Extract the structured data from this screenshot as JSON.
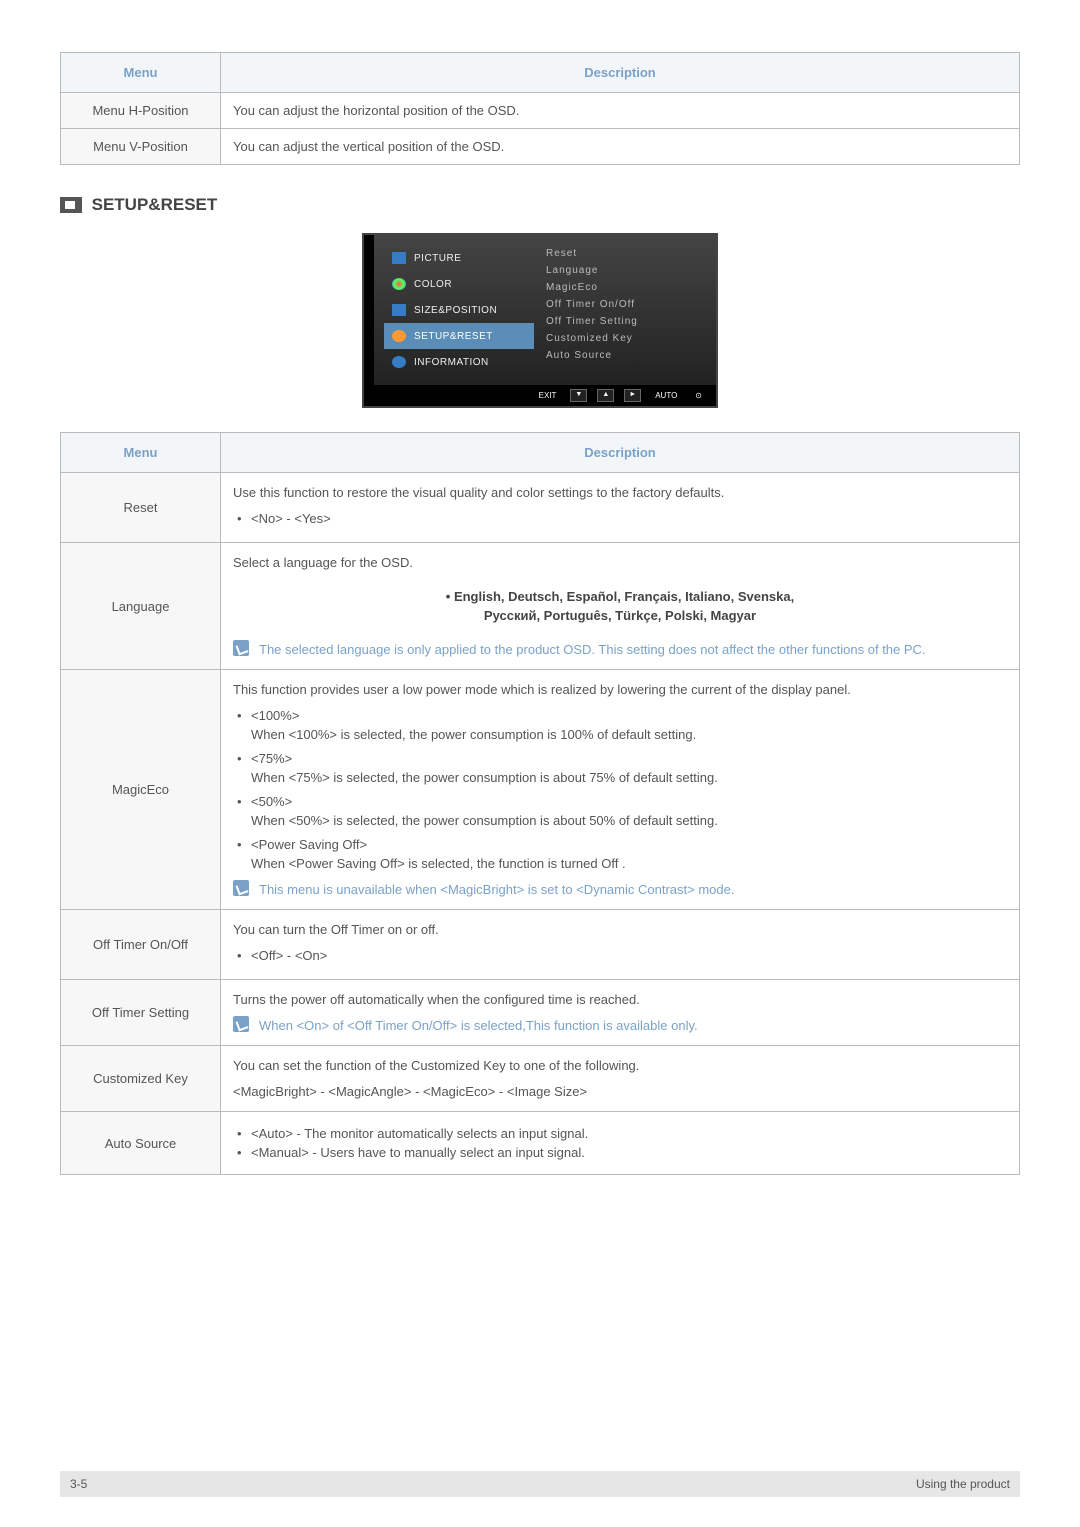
{
  "table1": {
    "headers": {
      "menu": "Menu",
      "description": "Description"
    },
    "rows": [
      {
        "menu": "Menu H-Position",
        "desc": "You can adjust the horizontal position of the OSD."
      },
      {
        "menu": "Menu V-Position",
        "desc": "You can adjust the vertical position of the OSD."
      }
    ]
  },
  "section_header": "SETUP&RESET",
  "osd": {
    "left": [
      {
        "label": "PICTURE",
        "icon": "mi-picture"
      },
      {
        "label": "COLOR",
        "icon": "mi-color"
      },
      {
        "label": "SIZE&POSITION",
        "icon": "mi-size"
      },
      {
        "label": "SETUP&RESET",
        "icon": "mi-setup",
        "selected": true
      },
      {
        "label": "INFORMATION",
        "icon": "mi-info"
      }
    ],
    "right": [
      "Reset",
      "Language",
      "MagicEco",
      "Off Timer On/Off",
      "Off Timer Setting",
      "Customized Key",
      "Auto Source"
    ],
    "bottom": {
      "exit": "EXIT",
      "down": "▼",
      "up": "▲",
      "right": "►",
      "auto": "AUTO",
      "enter": "⊙"
    }
  },
  "table2": {
    "headers": {
      "menu": "Menu",
      "description": "Description"
    },
    "rows": [
      {
        "menu": "Reset",
        "text": "Use this function to restore the visual quality and color settings to the factory defaults.",
        "bullets": [
          "<No> - <Yes>"
        ]
      },
      {
        "menu": "Language",
        "text": "Select a language for the OSD.",
        "bold": "• English, Deutsch, Español, Français, Italiano, Svenska,\nРусский, Português, Türkçe, Polski, Magyar",
        "note": "The selected language is only applied to the product OSD. This setting does not affect the other functions of the PC."
      },
      {
        "menu": "MagicEco",
        "text": "This function provides user a low power mode which is realized by lowering the current of the display panel.",
        "items": [
          {
            "head": "<100%>",
            "body": "When <100%> is selected, the power consumption is 100% of default setting."
          },
          {
            "head": "<75%>",
            "body": "When <75%> is selected, the power consumption is about 75% of default setting."
          },
          {
            "head": "<50%>",
            "body": "When <50%> is selected, the power consumption is about 50% of default setting."
          },
          {
            "head": "<Power Saving Off>",
            "body": "When <Power Saving Off> is selected, the function is turned Off ."
          }
        ],
        "note": "This menu is unavailable when <MagicBright> is set to <Dynamic Contrast> mode."
      },
      {
        "menu": "Off Timer On/Off",
        "text": "You can turn the Off Timer on or off.",
        "bullets": [
          "<Off> - <On>"
        ]
      },
      {
        "menu": "Off Timer Setting",
        "text": "Turns the power off automatically when the configured time is reached.",
        "note": "When <On> of <Off Timer On/Off> is selected,This function is available only."
      },
      {
        "menu": "Customized Key",
        "text": "You can set the function of the Customized Key to one of the following.",
        "text2": "<MagicBright> - <MagicAngle> - <MagicEco> - <Image Size>"
      },
      {
        "menu": "Auto Source",
        "bullets": [
          "<Auto> - The monitor automatically selects an input signal.",
          "<Manual> - Users have to manually select an input signal."
        ]
      }
    ]
  },
  "footer": {
    "left": "3-5",
    "right": "Using the product"
  }
}
